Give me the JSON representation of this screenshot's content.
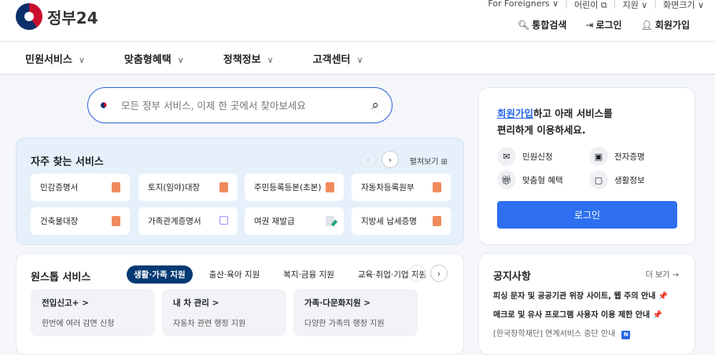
{
  "header": {
    "logo_text": "정부24",
    "util": [
      "For Foreigners ∨",
      "어린이 ⧉",
      "지원 ∨",
      "화면크기 ∨"
    ],
    "search_label": "통합검색",
    "login_label": "로그인",
    "signup_label": "회원가입"
  },
  "nav": [
    "민원서비스",
    "맞춤형혜택",
    "정책정보",
    "고객센터"
  ],
  "search": {
    "placeholder": "모든 정부 서비스, 이제 한 곳에서 찾아보세요"
  },
  "frequent": {
    "title": "자주 찾는 서비스",
    "expand": "펼쳐보기 ⊞",
    "items": [
      "인감증명서",
      "토지(임야)대장",
      "주민등록등본(초본)",
      "자동차등록원부",
      "건축물대장",
      "가족관계증명서",
      "여권 재발급",
      "지방세 납세증명"
    ]
  },
  "onestop": {
    "title": "원스톱 서비스",
    "tabs": [
      "생활·가족 지원",
      "출산·육아 지원",
      "복지·금융 지원",
      "교육·취업·기업 지원"
    ],
    "cards": [
      {
        "title": "전입신고+ >",
        "desc": "한번에 여러 감면 신청"
      },
      {
        "title": "내 차 관리 >",
        "desc": "자동차 관련 행정 지원"
      },
      {
        "title": "가족·다문화지원 >",
        "desc": "다양한 가족의 행정 지원"
      }
    ]
  },
  "login_card": {
    "link": "회원가입",
    "msg1": "하고 아래 서비스를",
    "msg2": "편리하게 이용하세요.",
    "services": [
      "민원신청",
      "전자증명",
      "맞춤형 혜택",
      "생활정보"
    ],
    "button": "로그인"
  },
  "notice": {
    "title": "공지사항",
    "more": "더 보기 →",
    "items": [
      "피싱 문자 및 공공기관 위장 사이트, 웹 주의 안내 📌",
      "매크로 및 유사 프로그램 사용자 이용 제한 안내 📌",
      "[한국장학재단] 연계서비스 중단 안내"
    ],
    "new_badge": "N"
  }
}
